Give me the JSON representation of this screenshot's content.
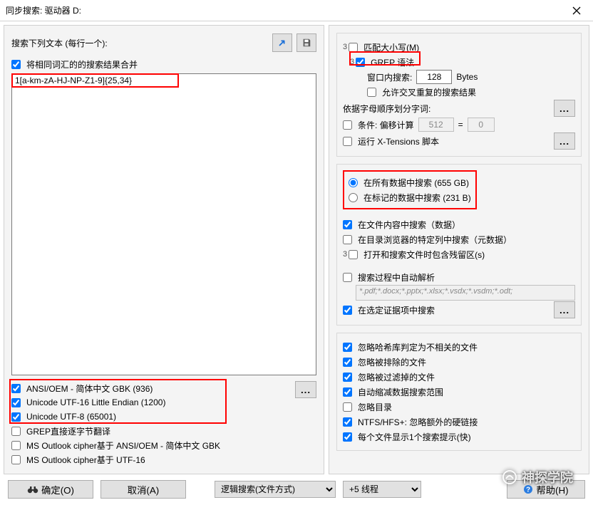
{
  "title": "同步搜索: 驱动器 D:",
  "left": {
    "prompt": "搜索下列文本 (每行一个):",
    "merge_label": "将相同词汇的的搜索结果合并",
    "search_text": "1[a-km-zA-HJ-NP-Z1-9]{25,34}",
    "encodings": [
      {
        "label": "ANSI/OEM - 简体中文 GBK (936)",
        "checked": true
      },
      {
        "label": "Unicode UTF-16 Little Endian (1200)",
        "checked": true
      },
      {
        "label": "Unicode UTF-8 (65001)",
        "checked": true
      },
      {
        "label": "GREP直接逐字节翻译",
        "checked": false
      },
      {
        "label": "MS Outlook cipher基于 ANSI/OEM - 简体中文 GBK",
        "checked": false
      },
      {
        "label": "MS Outlook cipher基于 UTF-16",
        "checked": false
      }
    ]
  },
  "right": {
    "match_case": "匹配大小写(M)",
    "grep": "GREP 语法",
    "window_label": "窗口内搜索:",
    "window_value": "128",
    "window_unit": "Bytes",
    "allow_overlap": "允许交叉重复的搜索结果",
    "split_label": "依据字母顺序划分字词:",
    "cond_label": "条件: 偏移计算",
    "cond_a": "512",
    "cond_eq": "=",
    "cond_b": "0",
    "run_xt": "运行 X-Tensions 脚本",
    "scope_all": "在所有数据中搜索 (655 GB)",
    "scope_tagged": "在标记的数据中搜索 (231 B)",
    "in_file_content": "在文件内容中搜索（数据）",
    "in_dir_cols": "在目录浏览器的特定列中搜索（元数据）",
    "include_slack": "打开和搜索文件时包含残留区(s)",
    "auto_parse": "搜索过程中自动解析",
    "auto_parse_exts": "*.pdf;*.docx;*.pptx;*.xlsx;*.vsdx;*.vsdm;*.odt;",
    "in_evidence": "在选定证据项中搜索",
    "ignore_hash": "忽略哈希库判定为不相关的文件",
    "ignore_excluded": "忽略被排除的文件",
    "ignore_filtered": "忽略被过滤掉的文件",
    "auto_shrink": "自动缩减数据搜索范围",
    "ignore_dirs": "忽略目录",
    "ntfs_hfs": "NTFS/HFS+: 忽略额外的硬链接",
    "per_file_hint": "每个文件显示1个搜索提示(快)"
  },
  "bottom": {
    "ok": "确定(O)",
    "cancel": "取消(A)",
    "mode": "逻辑搜索(文件方式)",
    "threads": "+5 线程",
    "help": "帮助(H)"
  },
  "watermark": "神探学院"
}
